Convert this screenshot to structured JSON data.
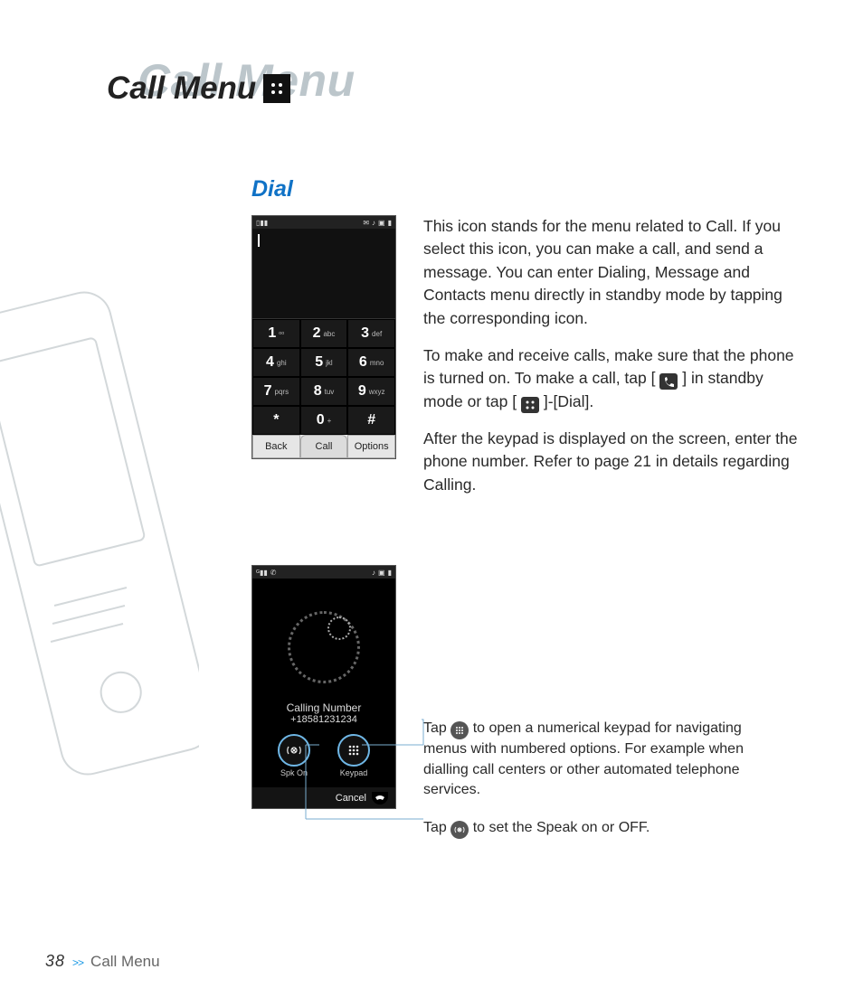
{
  "ghost_title": "Call Menu",
  "page_title": "Call Menu",
  "section_heading": "Dial",
  "para1": "This icon stands for the menu related to Call. If you select this icon, you can make a call, and send a message. You can enter Dialing, Message and Contacts menu directly in standby mode by tapping the corresponding icon.",
  "para2a": "To make and receive calls, make sure that the phone is turned on. To make a call, tap [ ",
  "para2b": " ] in standby mode or tap [ ",
  "para2c": " ]-[Dial].",
  "para3": "After the keypad is displayed on the screen, enter the phone number. Refer to page 21 in details regarding Calling.",
  "keypad": {
    "keys": [
      {
        "num": "1",
        "sub": "ᵒᵒ"
      },
      {
        "num": "2",
        "sub": "abc"
      },
      {
        "num": "3",
        "sub": "def"
      },
      {
        "num": "4",
        "sub": "ghi"
      },
      {
        "num": "5",
        "sub": "jkl"
      },
      {
        "num": "6",
        "sub": "mno"
      },
      {
        "num": "7",
        "sub": "pqrs"
      },
      {
        "num": "8",
        "sub": "tuv"
      },
      {
        "num": "9",
        "sub": "wxyz"
      },
      {
        "num": "*",
        "sub": ""
      },
      {
        "num": "0",
        "sub": "+"
      },
      {
        "num": "#",
        "sub": ""
      }
    ],
    "softkeys": {
      "left": "Back",
      "mid": "Call",
      "right": "Options"
    }
  },
  "call_screen": {
    "label": "Calling Number",
    "number": "+18581231234",
    "btn1": "Spk On",
    "btn2": "Keypad",
    "cancel": "Cancel"
  },
  "tip1a": "Tap ",
  "tip1b": " to open a numerical keypad for navigating menus with numbered options. For example when dialling call centers or other automated telephone services.",
  "tip2a": "Tap ",
  "tip2b": " to set the Speak on or OFF.",
  "footer": {
    "page": "38",
    "chev": ">>",
    "section": "Call Menu"
  }
}
